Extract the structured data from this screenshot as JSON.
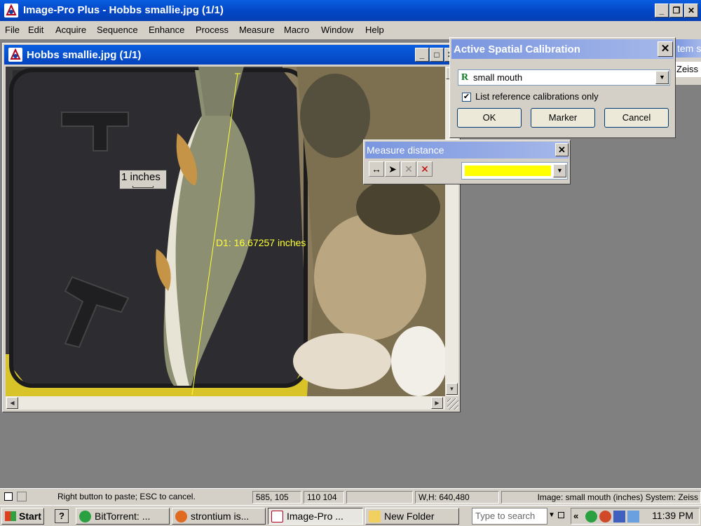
{
  "app": {
    "title": "Image-Pro Plus - Hobbs smallie.jpg (1/1)"
  },
  "menu": [
    "File",
    "Edit",
    "Acquire",
    "Sequence",
    "Enhance",
    "Process",
    "Measure",
    "Macro",
    "Window",
    "Help"
  ],
  "image_window": {
    "title": "Hobbs smallie.jpg (1/1)",
    "scale_bar_label": "1 inches",
    "measurement_label": "D1:  16.67257 inches",
    "line_color": "#ffff33"
  },
  "calibration_dialog": {
    "title": "Active Spatial Calibration",
    "selected_calibration": "small mouth",
    "calibration_glyph": "R",
    "checkbox_label": "List reference calibrations only",
    "checkbox_checked": true,
    "buttons": {
      "ok": "OK",
      "marker": "Marker",
      "cancel": "Cancel"
    }
  },
  "measure_panel": {
    "title": "Measure distance",
    "color": "#ffff00"
  },
  "background_panel": {
    "partial_title": "tem s",
    "partial_text": "Zeiss"
  },
  "status": {
    "hint": "Right button to paste; ESC to cancel.",
    "cursor": "585, 105",
    "rgb": "110 104",
    "size": "W,H: 640,480",
    "image_info": "Image: small mouth (inches) System: Zeiss"
  },
  "taskbar": {
    "start": "Start",
    "tasks": [
      "BitTorrent: ...",
      "strontium is...",
      "Image-Pro ...",
      "New Folder"
    ],
    "search_placeholder": "Type to search",
    "clock": "11:39 PM"
  }
}
